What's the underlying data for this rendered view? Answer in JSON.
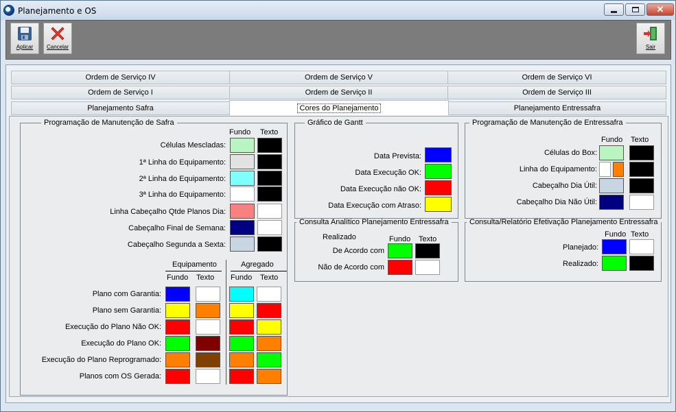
{
  "window": {
    "title": "Planejamento e OS"
  },
  "toolbar": {
    "apply_label": "Aplicar",
    "cancel_label": "Cancelar",
    "exit_label": "Sair"
  },
  "tabs": {
    "row1": [
      "Ordem de Serviço IV",
      "Ordem de Serviço V",
      "Ordem de Serviço VI"
    ],
    "row2": [
      "Ordem de Serviço I",
      "Ordem de Serviço II",
      "Ordem de Serviço III"
    ],
    "row3": [
      "Planejamento Safra",
      "Cores do Planejamento",
      "Planejamento Entressafra"
    ],
    "selected": "Cores do Planejamento"
  },
  "safra": {
    "legend": "Programação de Manutenção de Safra",
    "col_fundo": "Fundo",
    "col_texto": "Texto",
    "rows": [
      {
        "label": "Células Mescladas:",
        "fundo": "#b9f5c0",
        "texto": "#000000"
      },
      {
        "label": "1ª Linha do Equipamento:",
        "fundo": "#e2e2e2",
        "texto": "#000000"
      },
      {
        "label": "2ª Linha do Equipamento:",
        "fundo": "#80ffff",
        "texto": "#000000"
      },
      {
        "label": "3ª Linha do Equipamento:",
        "fundo": "#ffffff",
        "texto": "#000000"
      },
      {
        "label": "Linha Cabeçalho Qtde Planos Dia:",
        "fundo": "#f98080",
        "texto": "#ffffff"
      },
      {
        "label": "Cabeçalho Final de Semana:",
        "fundo": "#000080",
        "texto": "#ffffff"
      },
      {
        "label": "Cabeçalho Segunda a Sexta:",
        "fundo": "#c8d5e3",
        "texto": "#000000"
      }
    ],
    "equip_header": "Equipamento",
    "agreg_header": "Agregado",
    "plans": [
      {
        "label": "Plano com Garantia:",
        "eq_fundo": "#0000ff",
        "eq_texto": "#ffffff",
        "ag_fundo": "#00ffff",
        "ag_texto": "#ffffff"
      },
      {
        "label": "Plano sem Garantia:",
        "eq_fundo": "#ffff00",
        "eq_texto": "#ff8000",
        "ag_fundo": "#ffff00",
        "ag_texto": "#ff0000"
      },
      {
        "label": "Execução do Plano Não OK:",
        "eq_fundo": "#ff0000",
        "eq_texto": "#ffffff",
        "ag_fundo": "#ff0000",
        "ag_texto": "#ffff00"
      },
      {
        "label": "Execução do Plano OK:",
        "eq_fundo": "#00ff00",
        "eq_texto": "#800000",
        "ag_fundo": "#00ff00",
        "ag_texto": "#ff8000"
      },
      {
        "label": "Execução do Plano Reprogramado:",
        "eq_fundo": "#ff8000",
        "eq_texto": "#804000",
        "ag_fundo": "#ff8000",
        "ag_texto": "#00ff00"
      },
      {
        "label": "Planos com OS Gerada:",
        "eq_fundo": "#ff0000",
        "eq_texto": "#ffffff",
        "ag_fundo": "#ff0000",
        "ag_texto": "#ff8000"
      }
    ]
  },
  "gantt": {
    "legend": "Gráfico de Gantt",
    "rows": [
      {
        "label": "Data Prevista:",
        "color": "#0000ff"
      },
      {
        "label": "Data Execução OK:",
        "color": "#00ff00"
      },
      {
        "label": "Data Execução não OK:",
        "color": "#ff0000"
      },
      {
        "label": "Data Execução com Atraso:",
        "color": "#ffff00"
      }
    ]
  },
  "entressafra": {
    "legend": "Programação de Manutenção de Entressafra",
    "col_fundo": "Fundo",
    "col_texto": "Texto",
    "rows": [
      {
        "label": "Células do Box:",
        "fundo": "#b9f5c0",
        "texto": "#000000"
      },
      {
        "label": "Linha do Equipamento:",
        "fundo": "#ffffff",
        "fundo2": "#ff8000",
        "texto": "#000000"
      },
      {
        "label": "Cabeçalho Dia Útil:",
        "fundo": "#c8d5e3",
        "texto": "#000000"
      },
      {
        "label": "Cabeçalho Dia Não Útil:",
        "fundo": "#000080",
        "texto": "#ffffff"
      }
    ]
  },
  "analitico": {
    "legend": "Consulta Analítico Planejamento Entressafra",
    "sub": "Realizado",
    "col_fundo": "Fundo",
    "col_texto": "Texto",
    "rows": [
      {
        "label": "De Acordo com",
        "fundo": "#00ff00",
        "texto": "#000000"
      },
      {
        "label": "Não de Acordo com",
        "fundo": "#ff0000",
        "texto": "#ffffff"
      }
    ]
  },
  "efetivacao": {
    "legend": "Consulta/Relatório Efetivação Planejamento Entressafra",
    "col_fundo": "Fundo",
    "col_texto": "Texto",
    "rows": [
      {
        "label": "Planejado:",
        "fundo": "#0000ff",
        "texto": "#ffffff"
      },
      {
        "label": "Realizado:",
        "fundo": "#00ff00",
        "texto": "#000000"
      }
    ]
  }
}
